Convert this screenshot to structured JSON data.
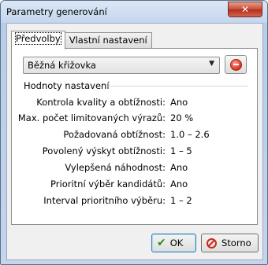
{
  "window": {
    "title": "Parametry generování",
    "close_glyph": "✕"
  },
  "tabs": [
    {
      "label": "Předvolby",
      "active": true
    },
    {
      "label": "Vlastní nastavení",
      "active": false
    }
  ],
  "preset": {
    "selected": "Běžná křižovka",
    "arrow_glyph": "▼",
    "remove_icon": "remove-icon"
  },
  "settings": {
    "group_title": "Hodnoty nastavení",
    "rows": [
      {
        "label": "Kontrola kvality a obtížnosti:",
        "value": "Ano"
      },
      {
        "label": "Max. počet limitovaných výrazů:",
        "value": "20 %"
      },
      {
        "label": "Požadovaná obtížnost:",
        "value": "1.0 – 2.6"
      },
      {
        "label": "Povolený výskyt obtížnosti:",
        "value": "1 – 5"
      },
      {
        "label": "Vylepšená náhodnost:",
        "value": "Ano"
      },
      {
        "label": "Prioritní výběr kandidátů:",
        "value": "Ano"
      },
      {
        "label": "Interval prioritního výběru:",
        "value": "1 – 2"
      }
    ]
  },
  "buttons": {
    "ok_label": "OK",
    "ok_icon": "✔",
    "cancel_label": "Storno"
  },
  "colors": {
    "titlebar": "#c4d6ee",
    "close": "#c64b37",
    "panel": "#ffffff",
    "client": "#f0f0f0"
  }
}
